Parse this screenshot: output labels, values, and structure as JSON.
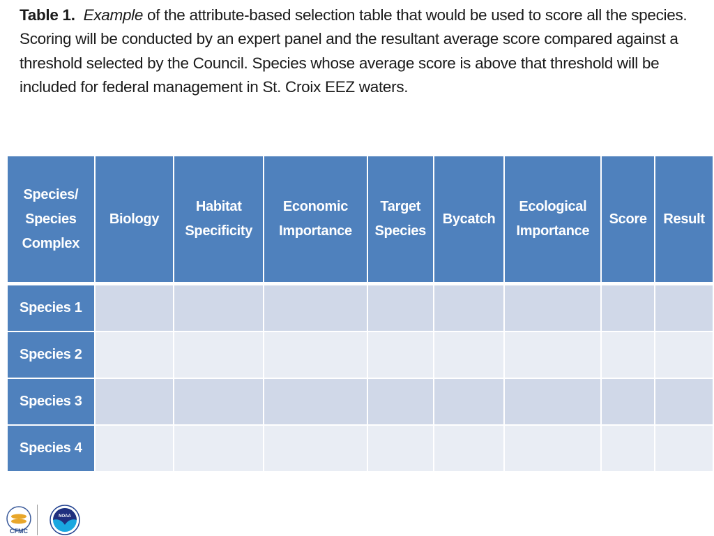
{
  "caption": {
    "label": "Table 1.",
    "italic": "Example",
    "text": " of the attribute-based selection table that would be used to score all the species.  Scoring will be conducted by an expert panel and the resultant average score compared against a threshold selected by the Council.  Species whose average score is above that threshold will be included for federal management in St. Croix EEZ waters."
  },
  "table": {
    "headers": [
      [
        "Species/",
        "Species",
        "Complex"
      ],
      [
        "Biology"
      ],
      [
        "Habitat",
        "Specificity"
      ],
      [
        "Economic",
        "Importance"
      ],
      [
        "Target",
        "Species"
      ],
      [
        "Bycatch"
      ],
      [
        "Ecological",
        "Importance"
      ],
      [
        "Score"
      ],
      [
        "Result"
      ]
    ],
    "rows": [
      "Species 1",
      "Species 2",
      "Species 3",
      "Species 4"
    ]
  },
  "colors": {
    "header": "#4f81bd",
    "row_odd": "#d0d8e8",
    "row_even": "#e9edf4"
  },
  "logos": {
    "left": "CFMC",
    "right": "NOAA"
  }
}
